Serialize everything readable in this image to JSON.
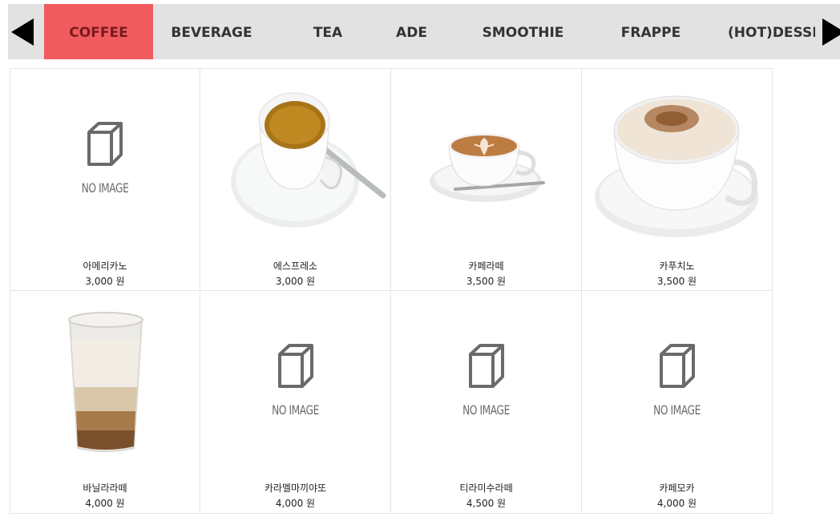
{
  "nav": {
    "prev_icon": "triangle-left-icon",
    "next_icon": "triangle-right-icon",
    "tabs": [
      {
        "label": "COFFEE",
        "active": true
      },
      {
        "label": "BEVERAGE",
        "active": false
      },
      {
        "label": "TEA",
        "active": false
      },
      {
        "label": "ADE",
        "active": false
      },
      {
        "label": "SMOOTHIE",
        "active": false
      },
      {
        "label": "FRAPPE",
        "active": false
      },
      {
        "label": "(HOT)DESSI",
        "active": false
      }
    ],
    "active_color": "#f05b5f",
    "bar_color": "#e2e2e2"
  },
  "placeholder": {
    "icon": "box-icon",
    "label": "NO IMAGE"
  },
  "products": [
    {
      "name": "아메리카노",
      "price": "3,000 원",
      "image": "none"
    },
    {
      "name": "에스프레소",
      "price": "3,000 원",
      "image": "espresso"
    },
    {
      "name": "카페라떼",
      "price": "3,500 원",
      "image": "latte"
    },
    {
      "name": "카푸치노",
      "price": "3,500 원",
      "image": "cappuccino"
    },
    {
      "name": "바닐라라떼",
      "price": "4,000 원",
      "image": "iced-latte"
    },
    {
      "name": "카라멜마끼야또",
      "price": "4,000 원",
      "image": "none"
    },
    {
      "name": "티라미수라떼",
      "price": "4,500 원",
      "image": "none"
    },
    {
      "name": "카페모카",
      "price": "4,000 원",
      "image": "none"
    }
  ]
}
